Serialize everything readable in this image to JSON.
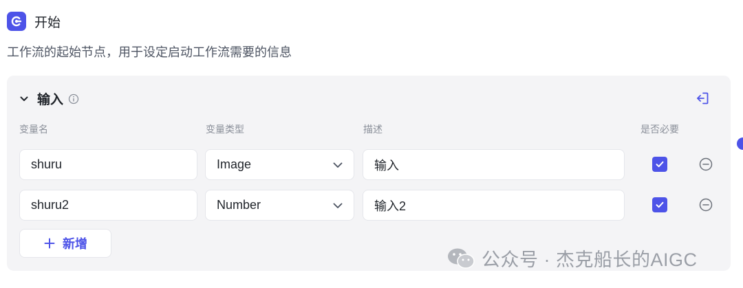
{
  "node": {
    "title": "开始",
    "description": "工作流的起始节点，用于设定启动工作流需要的信息",
    "icon": "start-node-icon"
  },
  "input_section": {
    "title": "输入",
    "columns": [
      "变量名",
      "变量类型",
      "描述",
      "是否必要"
    ],
    "rows": [
      {
        "name": "shuru",
        "type": "Image",
        "description": "输入",
        "required": true
      },
      {
        "name": "shuru2",
        "type": "Number",
        "description": "输入2",
        "required": true
      }
    ],
    "add_label": "新增"
  },
  "watermark": {
    "text": "公众号 · 杰克船长的AIGC"
  },
  "colors": {
    "accent": "#4d53e8",
    "panel": "#f4f4f6",
    "muted": "#8a8f99"
  }
}
